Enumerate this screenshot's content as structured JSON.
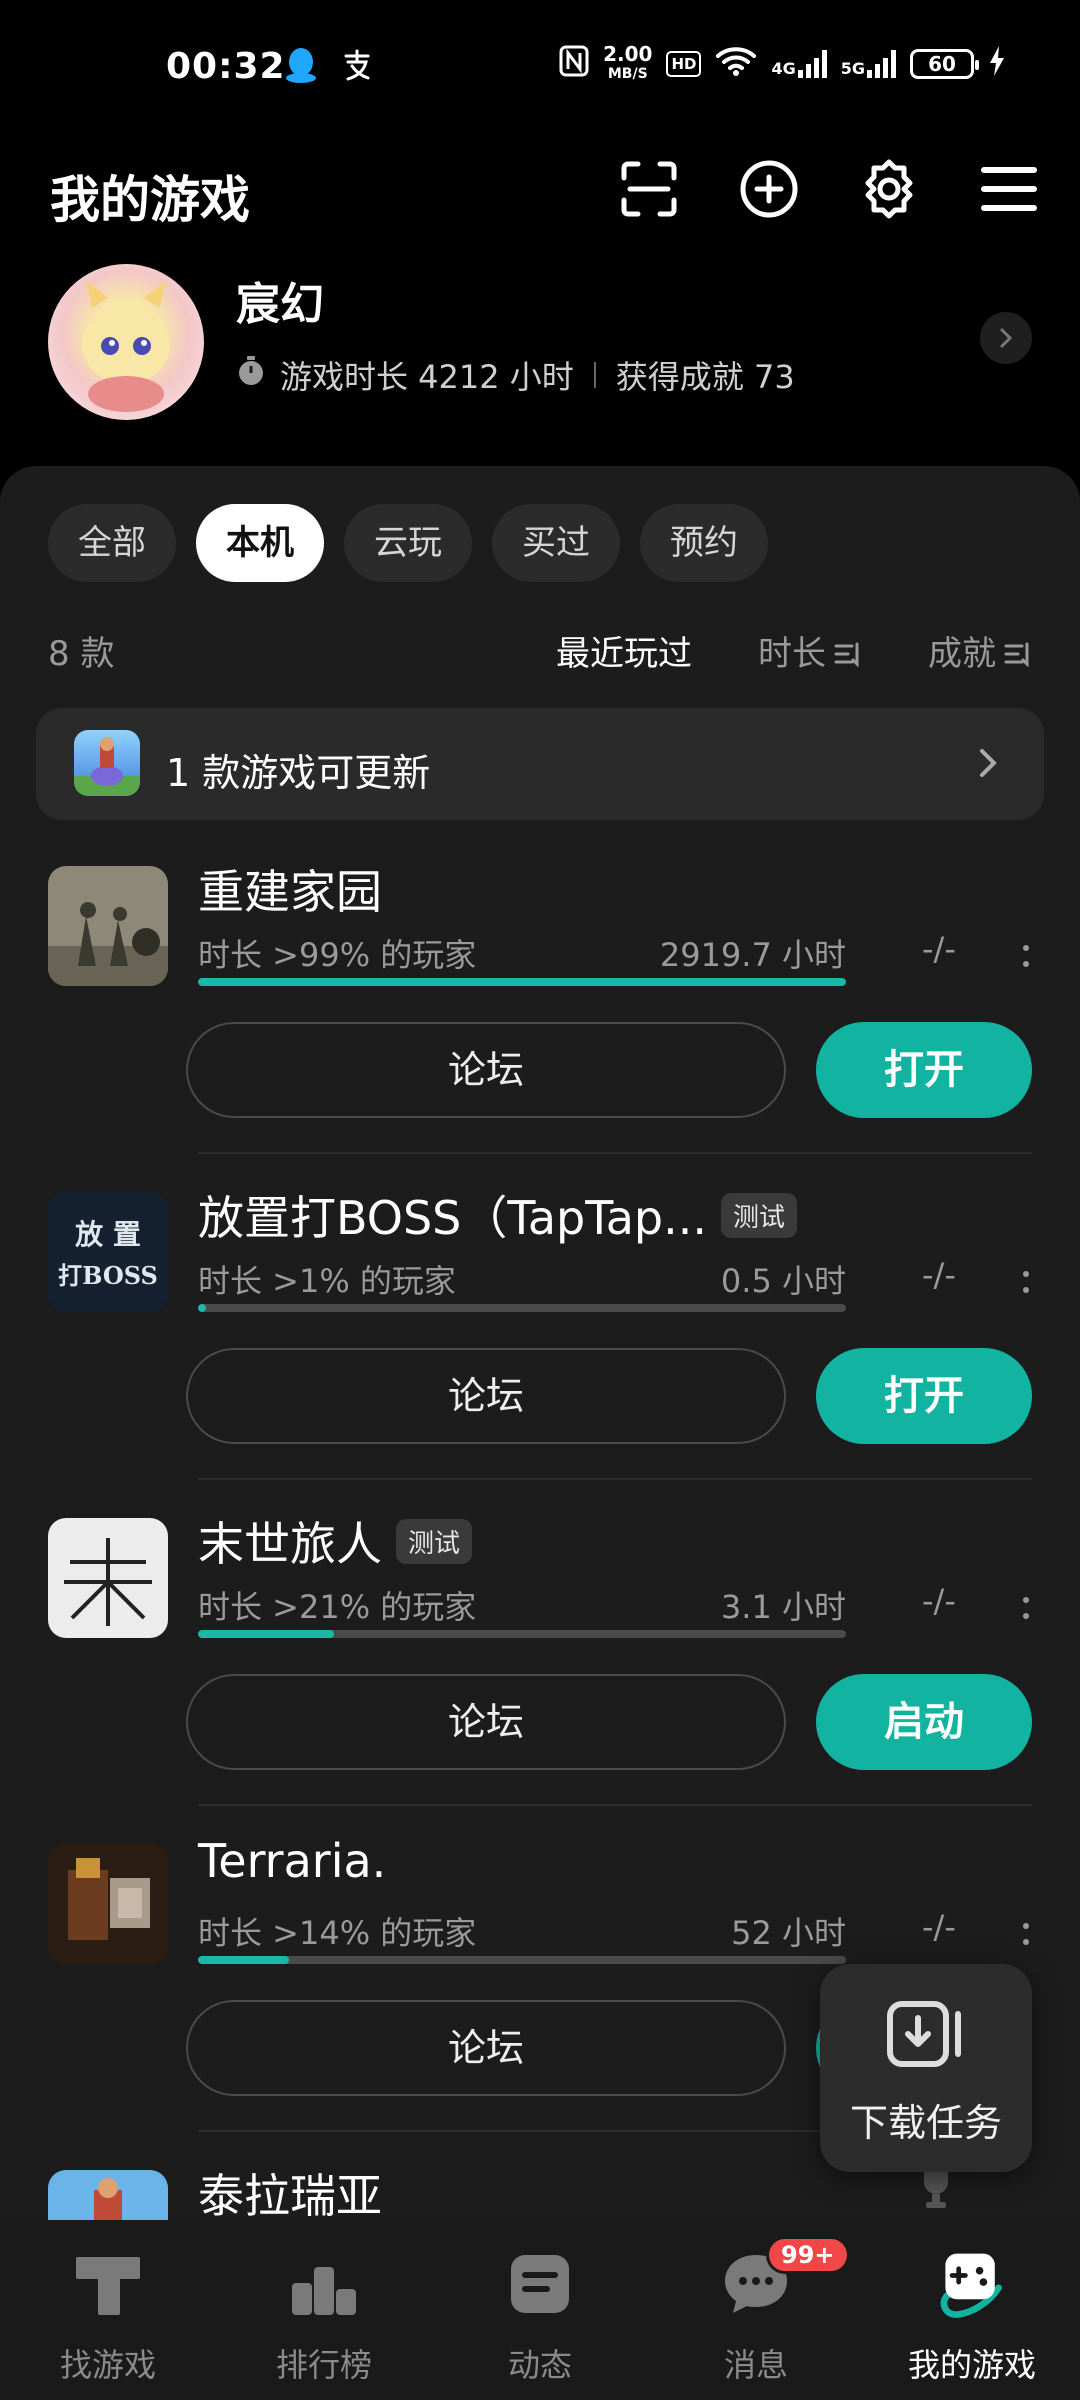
{
  "status_bar": {
    "time": "00:32",
    "speed_value": "2.00",
    "speed_unit": "MB/S",
    "hd": "HD",
    "net1": "4G",
    "net2": "5G",
    "battery": "60"
  },
  "header": {
    "title": "我的游戏"
  },
  "profile": {
    "username": "宸幻",
    "playtime": "游戏时长 4212 小时",
    "achievements": "获得成就 73"
  },
  "filters": [
    {
      "label": "全部",
      "active": false
    },
    {
      "label": "本机",
      "active": true
    },
    {
      "label": "云玩",
      "active": false
    },
    {
      "label": "买过",
      "active": false
    },
    {
      "label": "预约",
      "active": false
    }
  ],
  "sort": {
    "count": "8 款",
    "recent": "最近玩过",
    "duration": "时长",
    "achievement": "成就"
  },
  "update_bar": {
    "text": "1 款游戏可更新"
  },
  "games": [
    {
      "name": "重建家园",
      "badge": "",
      "rank": "时长 >99% 的玩家",
      "hours": "2919.7 小时",
      "ach": "-/-",
      "progress": 1.0,
      "forum": "论坛",
      "action": "打开"
    },
    {
      "name": "放置打BOSS（TapTap...",
      "badge": "测试",
      "rank": "时长 >1% 的玩家",
      "hours": "0.5 小时",
      "ach": "-/-",
      "progress": 0.01,
      "forum": "论坛",
      "action": "打开"
    },
    {
      "name": "末世旅人",
      "badge": "测试",
      "rank": "时长 >21% 的玩家",
      "hours": "3.1 小时",
      "ach": "-/-",
      "progress": 0.21,
      "forum": "论坛",
      "action": "启动"
    },
    {
      "name": "Terraria.",
      "badge": "",
      "rank": "时长 >14% 的玩家",
      "hours": "52 小时",
      "ach": "-/-",
      "progress": 0.14,
      "forum": "论坛",
      "action": ""
    },
    {
      "name": "泰拉瑞亚",
      "badge": "",
      "rank": "",
      "hours": "",
      "ach": "",
      "progress": 0,
      "forum": "",
      "action": ""
    }
  ],
  "download_float": {
    "label": "下载任务"
  },
  "bottom_nav": [
    {
      "label": "找游戏",
      "icon": "tap-icon"
    },
    {
      "label": "排行榜",
      "icon": "ranking-icon"
    },
    {
      "label": "动态",
      "icon": "feed-icon"
    },
    {
      "label": "消息",
      "icon": "message-icon",
      "badge": "99+"
    },
    {
      "label": "我的游戏",
      "icon": "gamepad-icon",
      "active": true
    }
  ],
  "colors": {
    "accent": "#12b3a0",
    "panel": "#1c1c1c",
    "badge": "#f04848"
  }
}
